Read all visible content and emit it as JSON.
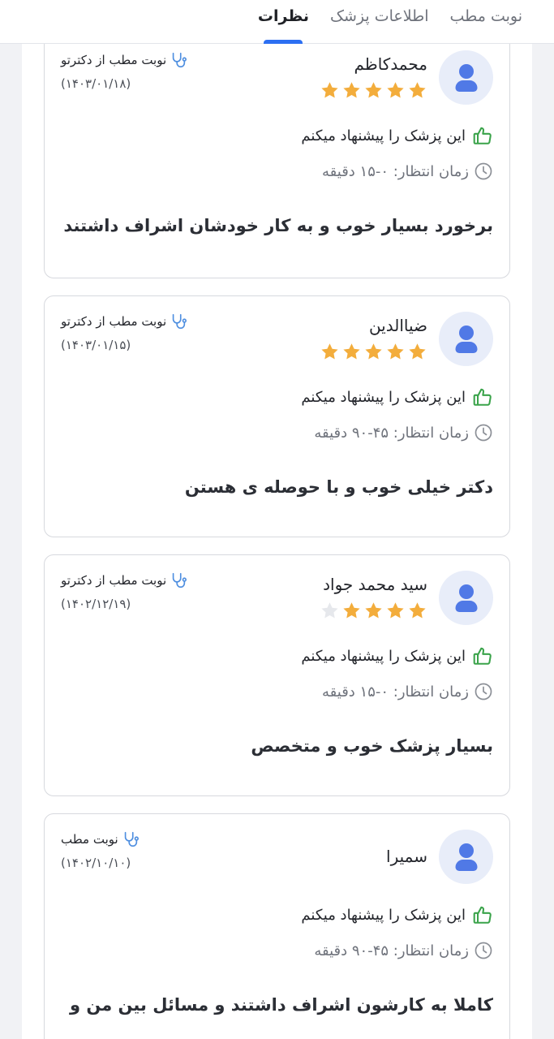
{
  "tabs": [
    {
      "label": "نوبت مطب",
      "active": false
    },
    {
      "label": "اطلاعات پزشک",
      "active": false
    },
    {
      "label": "نظرات",
      "active": true
    }
  ],
  "colors": {
    "accent": "#2c6ff2",
    "star_filled": "#f3ad3c",
    "star_empty": "#e6e8ec",
    "thumb_green": "#3aa34a",
    "avatar_bg": "#e8edf9",
    "avatar_fg": "#5079e6",
    "stethoscope": "#4f8fe0"
  },
  "icons": {
    "avatar": "user-avatar-icon",
    "rating": "star-icon",
    "source": "stethoscope-icon",
    "recommend": "thumbs-up-icon",
    "wait": "clock-icon"
  },
  "reviews": [
    {
      "name": "محمدکاظم",
      "rating": 5,
      "show_stars": true,
      "source": "نوبت مطب از دکترتو",
      "date": "(۱۴۰۳/۰۱/۱۸)",
      "recommend": "این پزشک را پیشنهاد میکنم",
      "wait": "زمان انتظار: ۰-۱۵ دقیقه",
      "comment": "برخورد بسیار خوب و به کار خودشان اشراف داشتند"
    },
    {
      "name": "ضیاالدین",
      "rating": 5,
      "show_stars": true,
      "source": "نوبت مطب از دکترتو",
      "date": "(۱۴۰۳/۰۱/۱۵)",
      "recommend": "این پزشک را پیشنهاد میکنم",
      "wait": "زمان انتظار: ۴۵-۹۰ دقیقه",
      "comment": "دکتر خیلی خوب و با حوصله ی هستن"
    },
    {
      "name": "سید محمد جواد",
      "rating": 4,
      "show_stars": true,
      "source": "نوبت مطب از دکترتو",
      "date": "(۱۴۰۲/۱۲/۱۹)",
      "recommend": "این پزشک را پیشنهاد میکنم",
      "wait": "زمان انتظار: ۰-۱۵ دقیقه",
      "comment": "بسیار پزشک خوب و متخصص"
    },
    {
      "name": "سمیرا",
      "rating": 0,
      "show_stars": false,
      "source": "نوبت مطب",
      "date": "(۱۴۰۲/۱۰/۱۰)",
      "recommend": "این پزشک را پیشنهاد میکنم",
      "wait": "زمان انتظار: ۴۵-۹۰ دقیقه",
      "comment": "کاملا به کارشون اشراف داشتند و مسائل بین من و"
    }
  ]
}
